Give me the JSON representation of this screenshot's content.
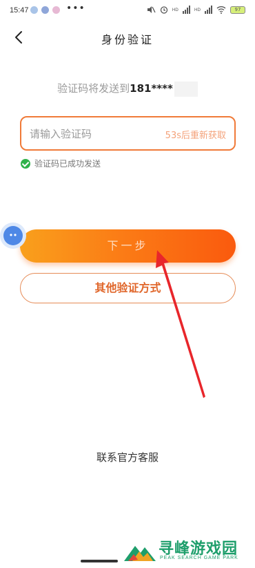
{
  "status_bar": {
    "time": "15:47",
    "more": "•••",
    "network_tag_1": "HD",
    "network_tag_2": "HD",
    "battery": "97"
  },
  "header": {
    "title": "身份验证"
  },
  "send_info": {
    "prefix": "验证码将发送到",
    "phone": "181****"
  },
  "code_field": {
    "placeholder": "请输入验证码",
    "value": "",
    "resend_label": "53s后重新获取"
  },
  "sent_status": {
    "text": "验证码已成功发送"
  },
  "actions": {
    "next_label": "下一步",
    "other_label": "其他验证方式"
  },
  "footer": {
    "service_label": "联系官方客服"
  },
  "watermark": {
    "title": "寻峰游戏园",
    "subtitle": "PEAK SEARCH GAME PARK"
  },
  "colors": {
    "accent": "#fb7d16",
    "accent_border": "#f07a38",
    "success": "#2fb24a",
    "annotation_arrow": "#e8262b"
  }
}
